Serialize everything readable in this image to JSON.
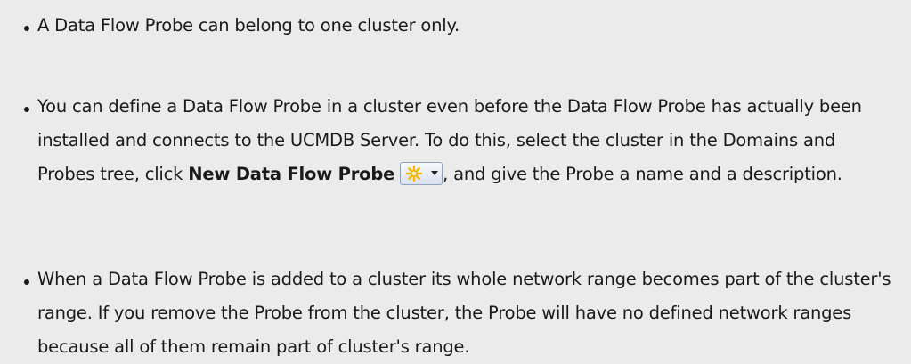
{
  "bullets": [
    {
      "text": "A Data Flow Probe can belong to one cluster only."
    },
    {
      "text_before": "You can define a Data Flow Probe in a cluster even before the Data Flow Probe has actually been installed and connects to the UCMDB Server. To do this, select the cluster in the Domains and Probes tree, click ",
      "bold": "New Data Flow Probe",
      "button_icon": "new-probe-star-icon",
      "text_after": ", and give the Probe a name and a description."
    },
    {
      "text": "When a Data Flow Probe is added to a cluster its whole network range becomes part of the cluster's range. If you remove the Probe from the cluster, the Probe will have no defined network ranges because all of them remain part of cluster's range."
    }
  ],
  "colors": {
    "background": "#ebebeb",
    "text": "#1a1a1a",
    "icon_star": "#f5b800"
  }
}
